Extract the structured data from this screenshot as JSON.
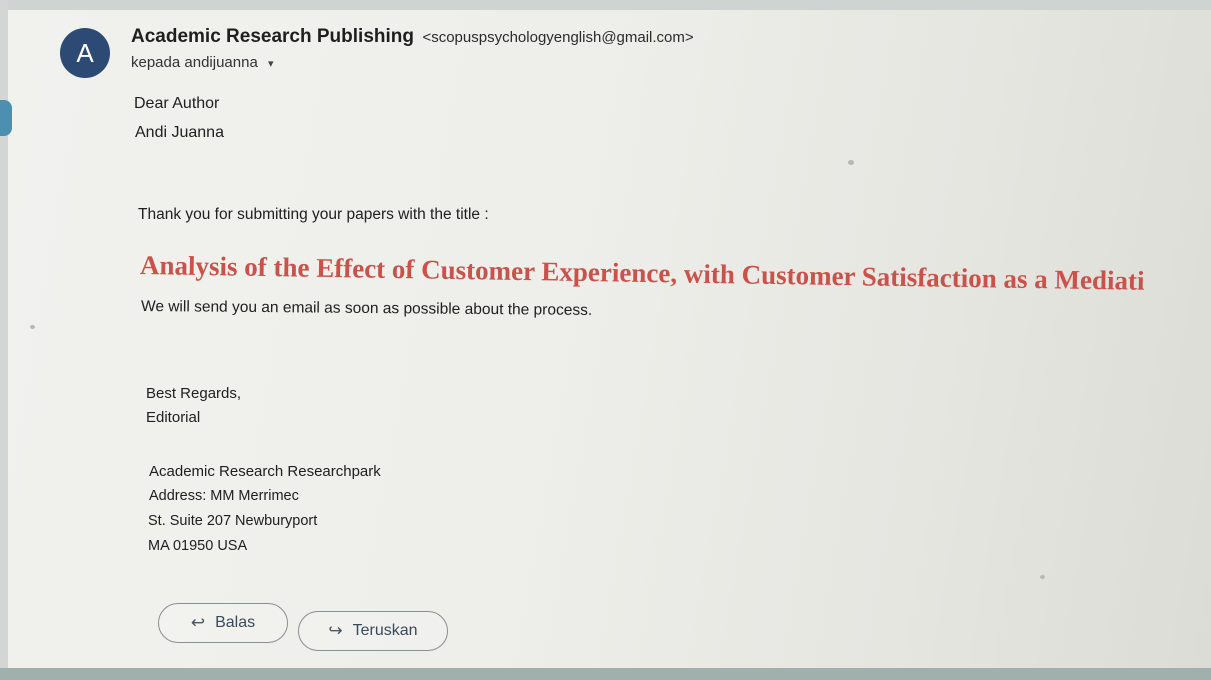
{
  "email": {
    "avatar_letter": "A",
    "sender_name": "Academic Research Publishing",
    "sender_email": "<scopuspsychologyenglish@gmail.com>",
    "recipient_text": "kepada andijuanna",
    "recipient_toggle_icon": "▾",
    "body": {
      "greeting_line_1": "Dear Author",
      "greeting_line_2": "Andi Juanna",
      "thanks_line": "Thank you for submitting your papers with the title :",
      "paper_title": "Analysis of the Effect of Customer Experience, with Customer Satisfaction as a Mediati",
      "process_line": "We will send you an email as soon as possible about the process.",
      "regards": "Best Regards,",
      "editorial": "Editorial",
      "org_name": "Academic Research Researchpark",
      "address_line_1": "Address: MM Merrimec",
      "address_line_2": "St. Suite 207 Newburyport",
      "address_line_3": "MA 01950 USA"
    },
    "actions": {
      "reply_label": "Balas",
      "reply_icon": "↩",
      "forward_label": "Teruskan",
      "forward_icon": "↪"
    }
  },
  "colors": {
    "title_color": "#c9524a",
    "avatar_bg": "#2c4a73",
    "side_tab": "#4d8fb0"
  }
}
